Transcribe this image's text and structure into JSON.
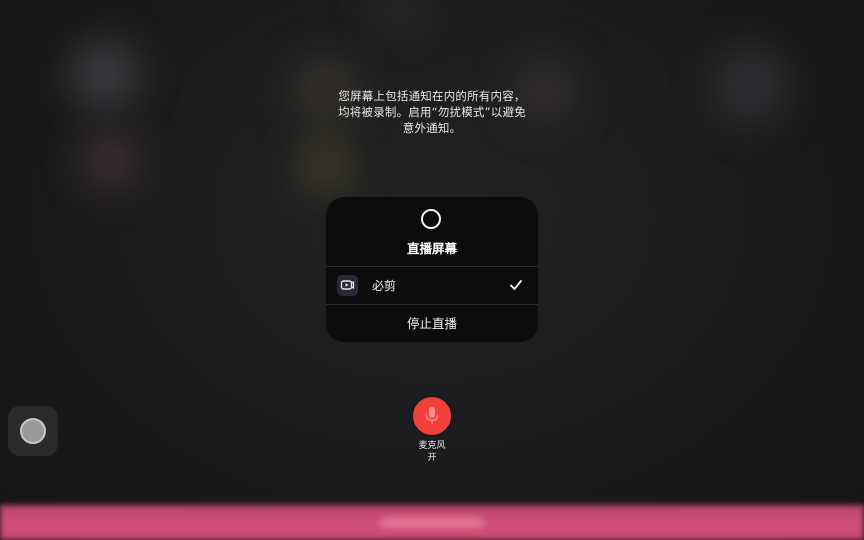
{
  "screen_recording": {
    "notice_line1": "您屏幕上包括通知在内的所有内容，",
    "notice_line2": "均将被录制。启用“勿扰模式”以避免",
    "notice_line3": "意外通知。",
    "panel_title": "直播屏幕",
    "app": {
      "name": "必剪",
      "selected": true,
      "icon": "bijian-app-icon"
    },
    "stop_label": "停止直播",
    "microphone": {
      "label_line1": "麦克风",
      "label_line2": "开",
      "color": "#f2403a",
      "icon": "microphone-icon"
    }
  },
  "colors": {
    "panel_bg": "#0c0c0d",
    "accent_bar": "#d04f7a"
  }
}
